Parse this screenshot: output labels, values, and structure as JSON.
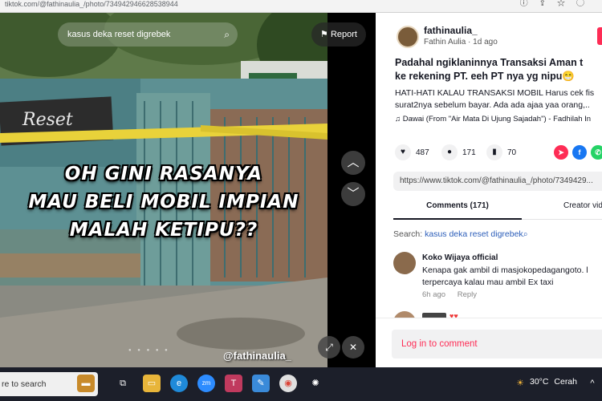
{
  "browser": {
    "url": "tiktok.com/@fathinaulia_/photo/734942946628538944",
    "icons": [
      "info-icon",
      "share-icon",
      "bookmark-star-icon",
      "profile-icon"
    ]
  },
  "viewer": {
    "search_placeholder": "kasus deka reset digrebek",
    "report_label": "Report",
    "overlay_lines": [
      "OH GINI RASANYA",
      "MAU BELI MOBIL IMPIAN",
      "MALAH KETIPU??"
    ],
    "watermark": "@fathinaulia_",
    "sign_text": "Reset",
    "up_icon": "chevron-up-icon",
    "down_icon": "chevron-down-icon",
    "mute_icon": "mute-icon",
    "fullscreen_icon": "expand-icon"
  },
  "panel": {
    "author": {
      "username": "fathinaulia_",
      "display_name": "Fathin Aulia",
      "separator": "·",
      "time": "1d ago"
    },
    "caption_title_lines": [
      "Padahal ngiklaninnya Transaksi Aman t",
      "ke rekening PT. eeh PT nya yg nipu😁"
    ],
    "caption_body_lines": [
      "HATI-HATI KALAU TRANSAKSI MOBIL Harus cek fis",
      "surat2nya sebelum bayar. Ada ada ajaa yaa orang,.."
    ],
    "music": "Dawai (From \"Air Mata Di Ujung Sajadah\") - Fadhilah In",
    "stats": {
      "likes": "487",
      "comments": "171",
      "saves": "70"
    },
    "share_colors": {
      "repost": "#fe2c55",
      "facebook": "#1877f2",
      "whatsapp": "#25d366"
    },
    "link": "https://www.tiktok.com/@fathinaulia_/photo/7349429...",
    "tabs": [
      {
        "label": "Comments (171)",
        "active": true
      },
      {
        "label": "Creator vid",
        "active": false
      }
    ],
    "search_prefix": "Search:",
    "search_term": "kasus deka reset digrebek",
    "comments": [
      {
        "name": "Koko Wijaya official",
        "text_lines": [
          "Kenapa gak ambil di masjokopedagangoto. l",
          "terpercaya kalau mau ambil Ex taxi"
        ],
        "time": "6h ago",
        "reply": "Reply"
      }
    ],
    "login_label": "Log in to comment"
  },
  "taskbar": {
    "search_text": "re to search",
    "temperature": "30°C",
    "weather": "Cerah"
  }
}
